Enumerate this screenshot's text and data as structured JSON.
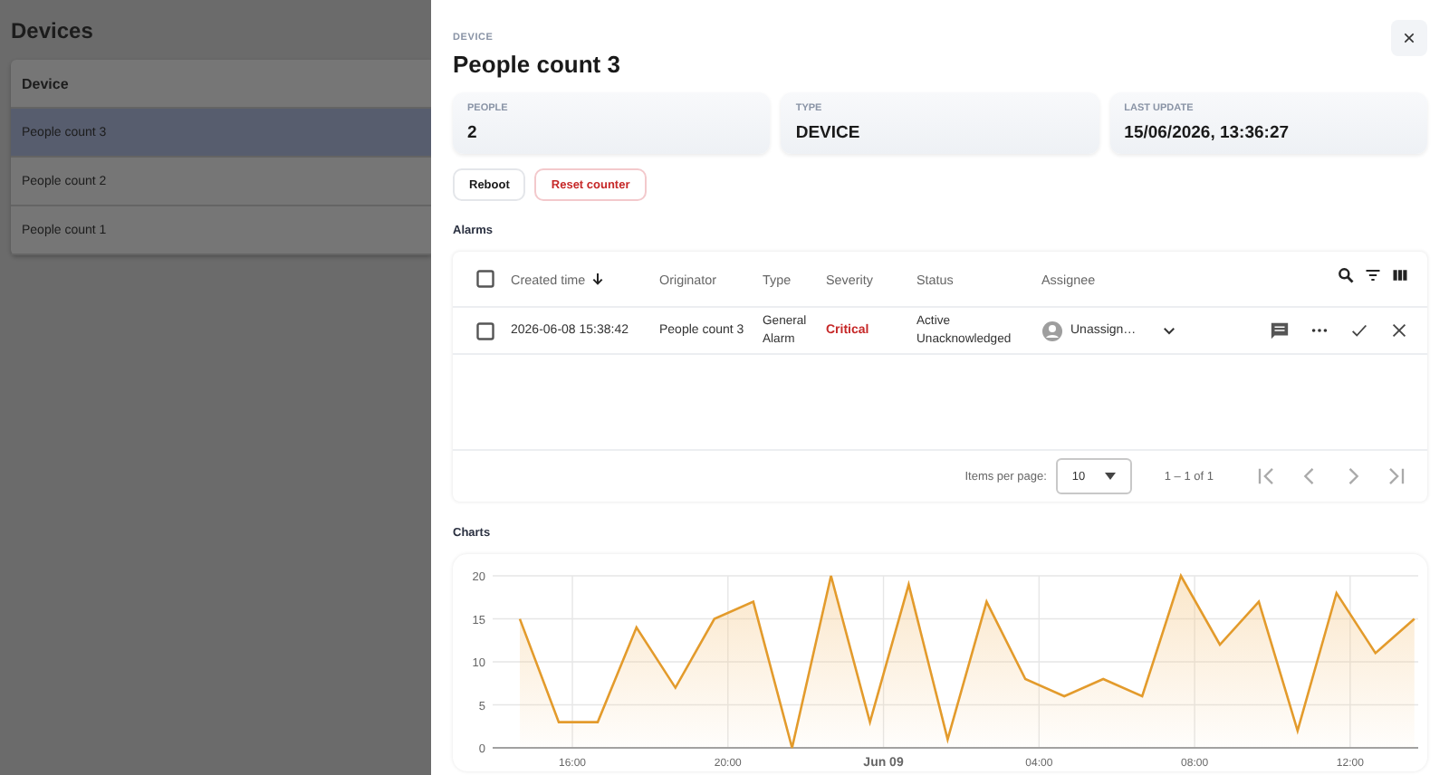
{
  "devices": {
    "title": "Devices",
    "column": "Device",
    "rows": [
      {
        "name": "People count 3",
        "selected": true
      },
      {
        "name": "People count 2",
        "selected": false
      },
      {
        "name": "People count 1",
        "selected": false
      }
    ]
  },
  "drawer": {
    "overline": "DEVICE",
    "title": "People count 3",
    "stats": [
      {
        "label": "PEOPLE",
        "value": "2"
      },
      {
        "label": "TYPE",
        "value": "DEVICE"
      },
      {
        "label": "LAST UPDATE",
        "value": "15/06/2026, 13:36:27"
      }
    ],
    "buttons": [
      {
        "label": "Reboot",
        "kind": "default"
      },
      {
        "label": "Reset counter",
        "kind": "danger"
      }
    ],
    "alarms": {
      "title": "Alarms",
      "all_checked": false,
      "columns": [
        "Created time",
        "Originator",
        "Type",
        "Severity",
        "Status",
        "Assignee"
      ],
      "rows": [
        {
          "checked": false,
          "created": "2026-06-08 15:38:42",
          "originator": "People count 3",
          "type": "General Alarm",
          "severity": "Critical",
          "color": "#c62828",
          "status": "Active Unacknowledged",
          "assignee": "Unassign…"
        }
      ],
      "items_per_page_label": "Items per page:",
      "items_per_page": "10",
      "range": "1 – 1 of 1"
    },
    "charts": {
      "title": "Charts",
      "chart_data": {
        "type": "area",
        "grid": true,
        "x": [
          "2026-06-08T14:39",
          "2026-06-08T15:39",
          "2026-06-08T16:39",
          "2026-06-08T17:39",
          "2026-06-08T18:39",
          "2026-06-08T19:39",
          "2026-06-08T20:39",
          "2026-06-08T21:39",
          "2026-06-08T22:39",
          "2026-06-08T23:39",
          "2026-06-09T00:39",
          "2026-06-09T01:39",
          "2026-06-09T02:39",
          "2026-06-09T03:39",
          "2026-06-09T04:39",
          "2026-06-09T05:39",
          "2026-06-09T06:39",
          "2026-06-09T07:39",
          "2026-06-09T08:39",
          "2026-06-09T09:39",
          "2026-06-09T10:39",
          "2026-06-09T11:39",
          "2026-06-09T12:39",
          "2026-06-09T13:39"
        ],
        "series": [
          {
            "color": "#e39b2c",
            "values": [
              15,
              3,
              3,
              14,
              7,
              15,
              17,
              0,
              20,
              3,
              19,
              1,
              17,
              8,
              6,
              8,
              6,
              20,
              12,
              17,
              2,
              18,
              11,
              15
            ]
          }
        ],
        "xlim": [
          "2026-06-08T13:57",
          "2026-06-09T13:45"
        ],
        "ylim": [
          0,
          20
        ],
        "xticks": [
          {
            "value": "2026-06-08T16:00",
            "label": "16:00"
          },
          {
            "value": "2026-06-08T20:00",
            "label": "20:00"
          },
          {
            "value": "2026-06-09T00:00",
            "label": "Jun 09"
          },
          {
            "value": "2026-06-09T04:00",
            "label": "04:00"
          },
          {
            "value": "2026-06-09T08:00",
            "label": "08:00"
          },
          {
            "value": "2026-06-09T12:00",
            "label": "12:00"
          }
        ],
        "yticks": [
          0,
          5,
          10,
          15,
          20
        ]
      }
    }
  }
}
